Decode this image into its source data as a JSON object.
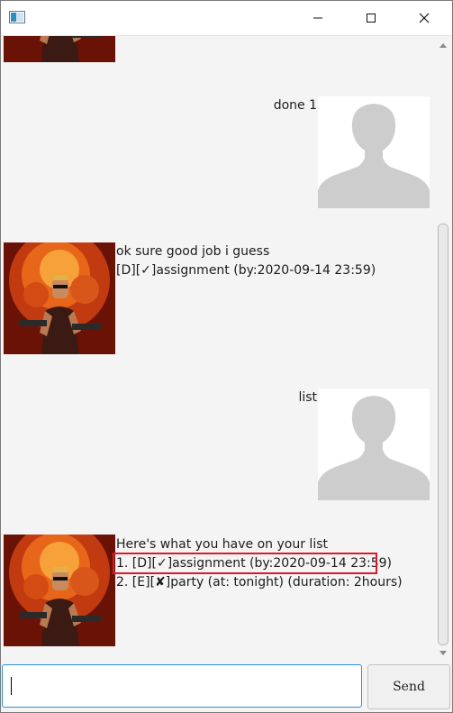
{
  "window": {
    "title": ""
  },
  "chat": {
    "messages": [
      {
        "sender": "user",
        "lines": [
          "done 1"
        ]
      },
      {
        "sender": "bot",
        "lines": [
          "ok sure good job i guess",
          "[D][✓]assignment (by:2020-09-14 23:59)"
        ]
      },
      {
        "sender": "user",
        "lines": [
          "list"
        ]
      },
      {
        "sender": "bot",
        "lines": [
          "Here's what you have on your list",
          "1. [D][✓]assignment (by:2020-09-14 23:59)",
          "2. [E][✘]party (at: tonight) (duration: 2hours)"
        ]
      }
    ]
  },
  "input": {
    "value": "",
    "placeholder": ""
  },
  "send_button": {
    "label": "Send"
  },
  "colors": {
    "highlight": "#e0192a",
    "input_focus": "#2b8fd6",
    "background": "#f4f4f4"
  }
}
